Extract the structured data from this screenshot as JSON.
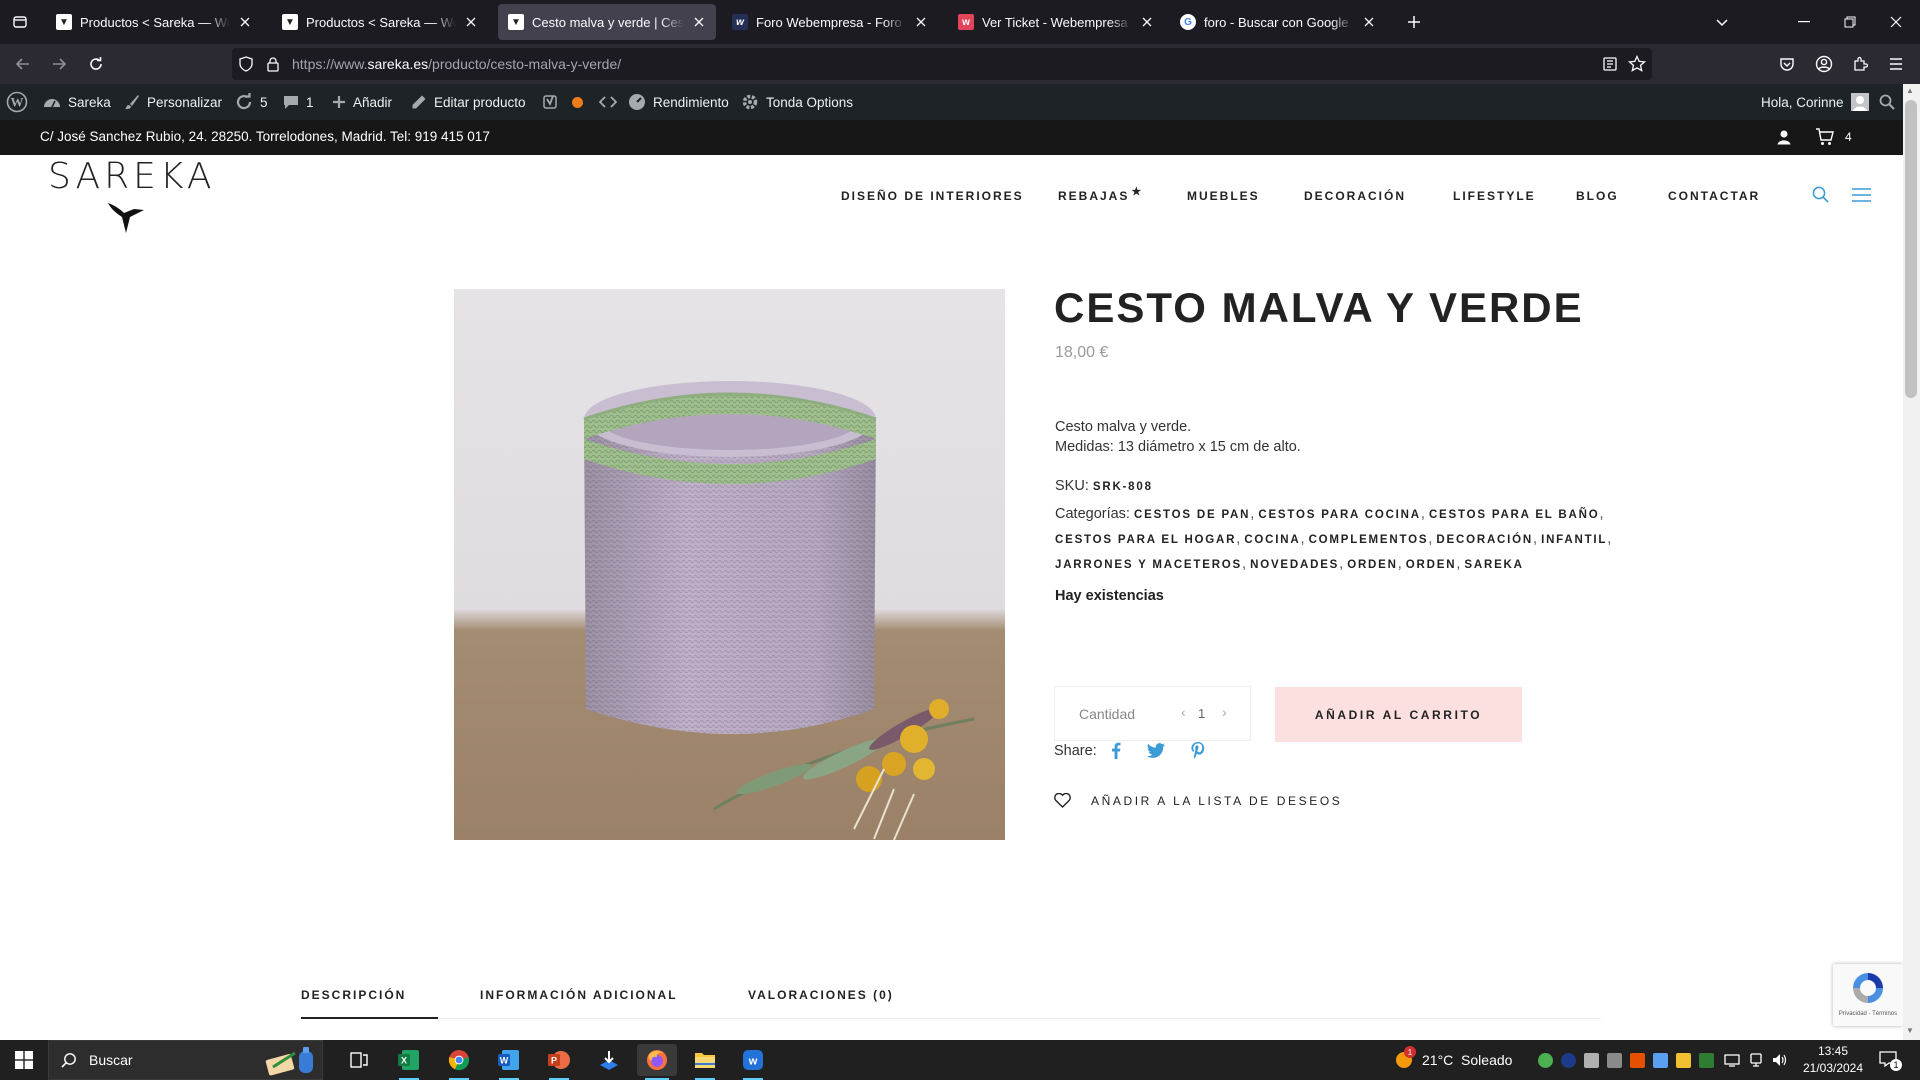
{
  "browser": {
    "tabs": [
      {
        "title": "Productos < Sareka — WordPress",
        "favicon": "site-favicon",
        "active": false
      },
      {
        "title": "Productos < Sareka — WordPress",
        "favicon": "site-favicon",
        "active": false
      },
      {
        "title": "Cesto malva y verde | Cesta de",
        "favicon": "site-favicon",
        "active": true
      },
      {
        "title": "Foro Webempresa - Foro WordP",
        "favicon": "webempresa-favicon",
        "active": false
      },
      {
        "title": "Ver Ticket - Webempresa Europ",
        "favicon": "webempresa-ticket-favicon",
        "active": false
      },
      {
        "title": "foro - Buscar con Google",
        "favicon": "google-favicon",
        "active": false
      }
    ],
    "url_prefix": "https://www.",
    "url_domain": "sareka.es",
    "url_path": "/producto/cesto-malva-y-verde/"
  },
  "wp_admin_bar": {
    "site_name": "Sareka",
    "customize": "Personalizar",
    "updates_count": "5",
    "comments_count": "1",
    "add_new": "Añadir",
    "edit_product": "Editar producto",
    "performance": "Rendimiento",
    "theme_options": "Tonda Options",
    "greeting": "Hola, Corinne"
  },
  "info_bar": {
    "address": "C/ José Sanchez Rubio, 24. 28250. Torrelodones, Madrid. Tel:",
    "phone": "919 415 017",
    "cart_count": "4"
  },
  "header": {
    "logo_text": "SAREKA",
    "menu": [
      "DISEÑO DE INTERIORES",
      "REBAJAS",
      "MUEBLES",
      "DECORACIÓN",
      "LIFESTYLE",
      "BLOG",
      "CONTACTAR"
    ],
    "rebajas_mark": "★"
  },
  "product": {
    "title": "CESTO MALVA Y VERDE",
    "price": "18,00 €",
    "desc_line1": "Cesto malva y verde.",
    "desc_line2": "Medidas: 13 diámetro x 15 cm de alto.",
    "sku_label": "SKU:",
    "sku": "SRK-808",
    "categories_label": "Categorías:",
    "categories": [
      "CESTOS DE PAN",
      "CESTOS PARA COCINA",
      "CESTOS PARA EL BAÑO",
      "CESTOS PARA EL HOGAR",
      "COCINA",
      "COMPLEMENTOS",
      "DECORACIÓN",
      "INFANTIL",
      "JARRONES Y MACETEROS",
      "NOVEDADES",
      "ORDEN",
      "ORDEN",
      "SAREKA"
    ],
    "stock": "Hay existencias",
    "quantity_label": "Cantidad",
    "quantity": "1",
    "add_to_cart": "AÑADIR AL CARRITO",
    "share_label": "Share:",
    "wishlist": "AÑADIR A LA LISTA DE DESEOS"
  },
  "product_tabs": [
    "DESCRIPCIÓN",
    "INFORMACIÓN ADICIONAL",
    "VALORACIONES (0)"
  ],
  "recaptcha": {
    "label": "Privacidad - Términos"
  },
  "taskbar": {
    "search_placeholder": "Buscar",
    "weather": "21°C  Soleado",
    "weather_badge": "1",
    "time": "13:45",
    "date": "21/03/2024",
    "notification_count": "1"
  },
  "colors": {
    "accent_blue": "#3a9bd5",
    "cart_button": "#fbe0df",
    "wp_bar": "#1d2327",
    "firefox_dark": "#1c1b22"
  }
}
